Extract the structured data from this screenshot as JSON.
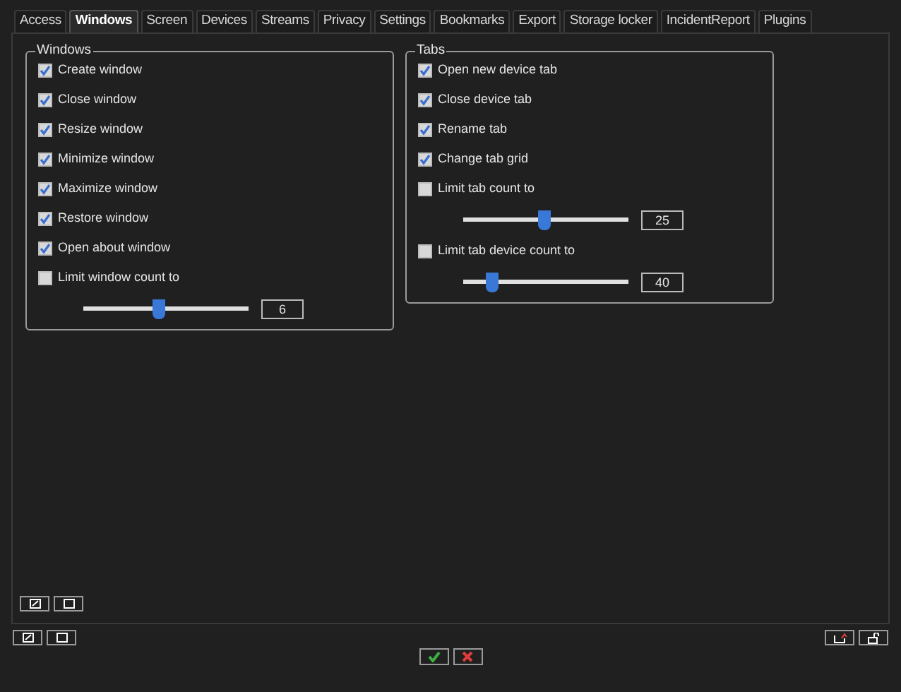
{
  "tabs": [
    {
      "label": "Access",
      "selected": false
    },
    {
      "label": "Windows",
      "selected": true
    },
    {
      "label": "Screen",
      "selected": false
    },
    {
      "label": "Devices",
      "selected": false
    },
    {
      "label": "Streams",
      "selected": false
    },
    {
      "label": "Privacy",
      "selected": false
    },
    {
      "label": "Settings",
      "selected": false
    },
    {
      "label": "Bookmarks",
      "selected": false
    },
    {
      "label": "Export",
      "selected": false
    },
    {
      "label": "Storage locker",
      "selected": false
    },
    {
      "label": "IncidentReport",
      "selected": false
    },
    {
      "label": "Plugins",
      "selected": false
    }
  ],
  "groups": [
    {
      "title": "Windows",
      "items": [
        {
          "kind": "checkbox",
          "label": "Create window",
          "checked": true
        },
        {
          "kind": "checkbox",
          "label": "Close window",
          "checked": true
        },
        {
          "kind": "checkbox",
          "label": "Resize window",
          "checked": true
        },
        {
          "kind": "checkbox",
          "label": "Minimize window",
          "checked": true
        },
        {
          "kind": "checkbox",
          "label": "Maximize window",
          "checked": true
        },
        {
          "kind": "checkbox",
          "label": "Restore window",
          "checked": true
        },
        {
          "kind": "checkbox",
          "label": "Open about window",
          "checked": true
        },
        {
          "kind": "checkbox",
          "label": "Limit window count to",
          "checked": false
        },
        {
          "kind": "slider",
          "level": 0.45,
          "value": "6"
        }
      ]
    },
    {
      "title": "Tabs",
      "items": [
        {
          "kind": "checkbox",
          "label": "Open new device tab",
          "checked": true
        },
        {
          "kind": "checkbox",
          "label": "Close device tab",
          "checked": true
        },
        {
          "kind": "checkbox",
          "label": "Rename tab",
          "checked": true
        },
        {
          "kind": "checkbox",
          "label": "Change tab grid",
          "checked": true
        },
        {
          "kind": "checkbox",
          "label": "Limit tab count to",
          "checked": false
        },
        {
          "kind": "slider",
          "level": 0.49,
          "value": "25"
        },
        {
          "kind": "checkbox",
          "label": "Limit tab device count to",
          "checked": false
        },
        {
          "kind": "slider",
          "level": 0.17,
          "value": "40"
        }
      ]
    }
  ]
}
